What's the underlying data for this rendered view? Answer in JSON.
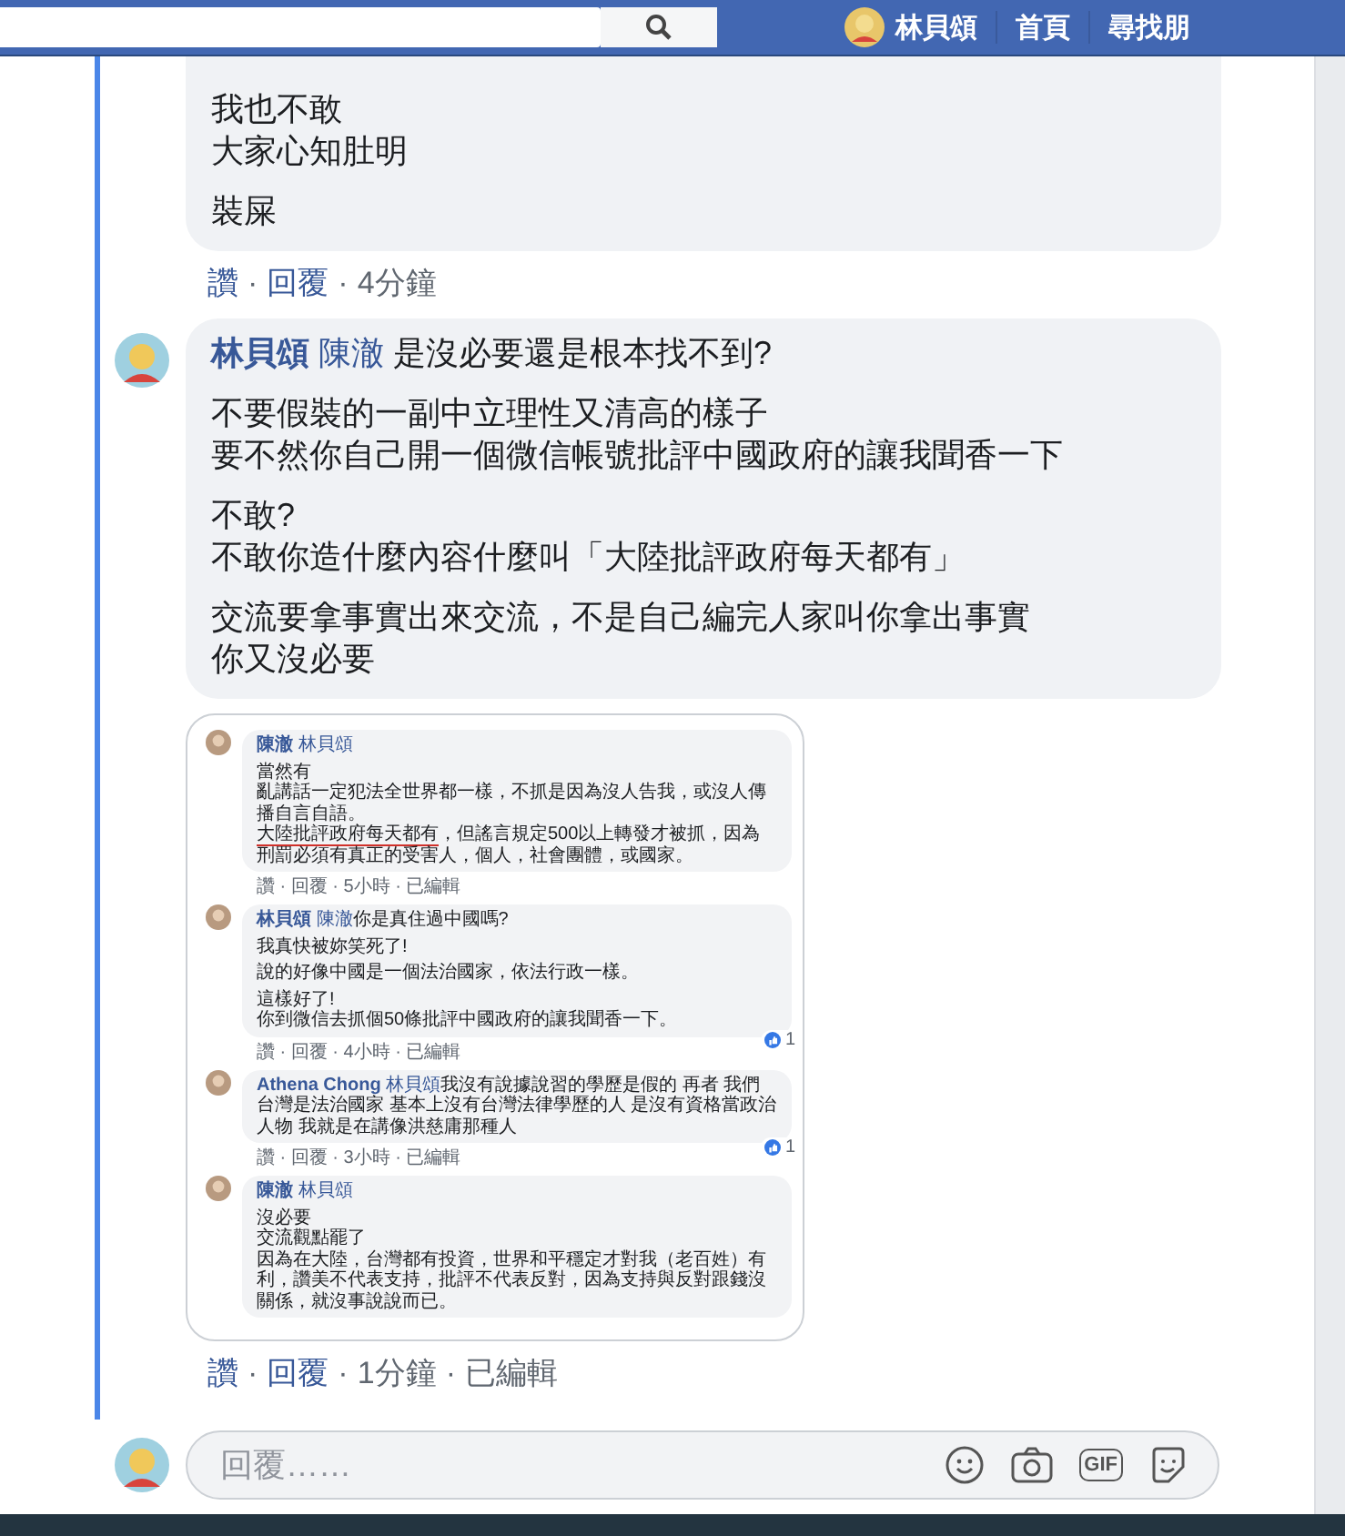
{
  "top_bar": {
    "profile_name": "林貝頌",
    "nav": [
      "首頁",
      "尋找朋"
    ]
  },
  "separator": "·",
  "comments": [
    {
      "paragraphs": [
        [
          "我也不敢",
          "大家心知肚明"
        ],
        [
          "裝屎"
        ]
      ],
      "meta": [
        {
          "label": "讚",
          "link": true
        },
        {
          "label": "回覆",
          "link": true
        },
        {
          "label": "4分鐘",
          "link": false
        }
      ]
    },
    {
      "author": "林貝頌",
      "mention": "陳澈",
      "lead": "是沒必要還是根本找不到?",
      "paragraphs": [
        [
          "不要假裝的一副中立理性又清高的樣子",
          "要不然你自己開一個微信帳號批評中國政府的讓我聞香一下"
        ],
        [
          "不敢?",
          "不敢你造什麼內容什麼叫「大陸批評政府每天都有」"
        ],
        [
          "交流要拿事實出來交流，不是自己編完人家叫你拿出事實",
          "你又沒必要"
        ]
      ],
      "attachment": {
        "kind": "screenshot",
        "comments": [
          {
            "author": "陳澈",
            "mention": "林貝頌",
            "paragraphs": [
              [
                "當然有",
                "亂講話一定犯法全世界都一樣，不抓是因為沒人告我，或沒人傳播自言自語。",
                {
                  "underlined": "大陸批評政府每天都有",
                  "rest": "，但謠言規定500以上轉發才被抓，因為刑罰必須有真正的受害人，個人，社會團體，或國家。"
                }
              ]
            ],
            "meta": "讚 · 回覆 · 5小時 · 已編輯"
          },
          {
            "author": "林貝頌",
            "mention": "陳澈",
            "lead": "你是真住過中國嗎?",
            "paragraphs": [
              [
                "我真快被妳笑死了!"
              ],
              [
                "說的好像中國是一個法治國家，依法行政一樣。"
              ],
              [
                "這樣好了!",
                "你到微信去抓個50條批評中國政府的讓我聞香一下。"
              ]
            ],
            "meta": "讚 · 回覆 · 4小時 · 已編輯",
            "likes": "1"
          },
          {
            "author": "Athena Chong",
            "mention": "林貝頌",
            "lead": "我沒有說據說習的學歷是假的 再者 我們台灣是法治國家 基本上沒有台灣法律學歷的人 是沒有資格當政治人物 我就是在講像洪慈庸那種人",
            "meta": "讚 · 回覆 · 3小時 · 已編輯",
            "likes": "1"
          },
          {
            "author": "陳澈",
            "mention": "林貝頌",
            "paragraphs": [
              [
                "沒必要",
                "交流觀點罷了",
                "因為在大陸，台灣都有投資，世界和平穩定才對我（老百姓）有利，讚美不代表支持，批評不代表反對，因為支持與反對跟錢沒關係，就沒事說說而已。"
              ]
            ]
          }
        ]
      },
      "meta": [
        {
          "label": "讚",
          "link": true
        },
        {
          "label": "回覆",
          "link": true
        },
        {
          "label": "1分鐘",
          "link": false
        },
        {
          "label": "已編輯",
          "link": false
        }
      ]
    }
  ],
  "reply_box": {
    "placeholder": "回覆……",
    "gif_label": "GIF"
  }
}
